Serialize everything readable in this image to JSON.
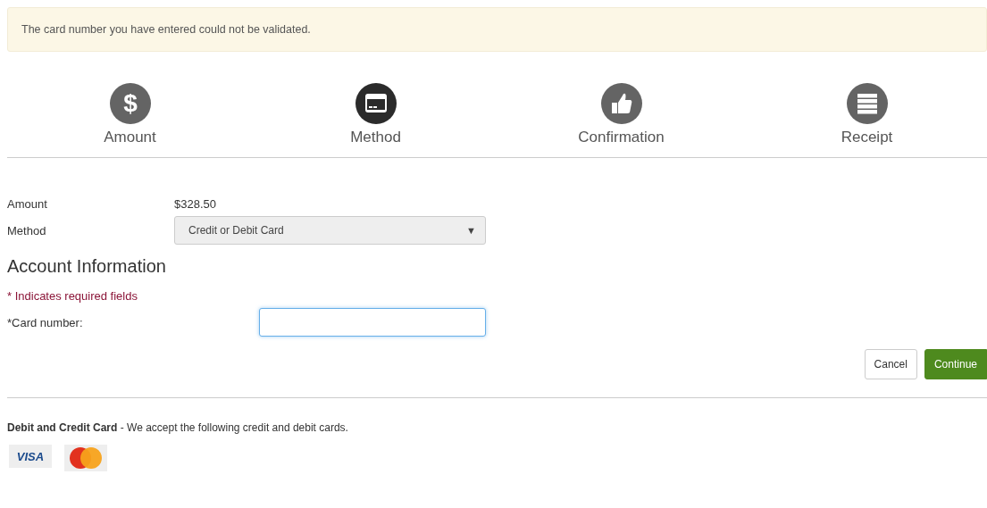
{
  "alert": {
    "message": "The card number you have entered could not be validated."
  },
  "steps": [
    {
      "kind": "dollar",
      "glyph": "$",
      "label": "Amount",
      "selected": false
    },
    {
      "kind": "card",
      "label": "Method",
      "selected": true
    },
    {
      "kind": "thumb",
      "label": "Confirmation",
      "selected": false
    },
    {
      "kind": "list",
      "label": "Receipt",
      "selected": false
    }
  ],
  "summary": [
    {
      "label": "Amount",
      "kind": "text",
      "value": "$328.50"
    },
    {
      "label": "Method",
      "kind": "select",
      "value": "Credit or Debit Card",
      "arrow": "▼"
    }
  ],
  "account": {
    "heading": "Account Information",
    "required_note": "* Indicates required fields",
    "card_label": "*Card number:"
  },
  "buttons": [
    {
      "label": "Cancel",
      "kind": "secondary"
    },
    {
      "label": "Continue",
      "kind": "primary"
    }
  ],
  "footer": {
    "text": "**Debit and Credit Card** - We accept the following credit and debit cards.",
    "cards": [
      {
        "kind": "visa",
        "label": "VISA"
      },
      {
        "kind": "mastercard"
      }
    ]
  }
}
